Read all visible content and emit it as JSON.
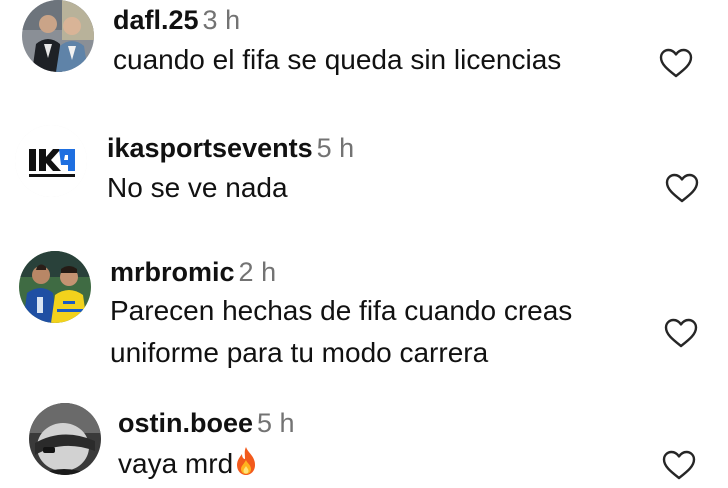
{
  "comments": [
    {
      "username": "dafl.25",
      "time": "3 h",
      "text": "cuando el fifa se queda sin licencias",
      "avatar_icon": "two-men-suits-photo"
    },
    {
      "username": "ikasportsevents",
      "time": "5 h",
      "text": "No se ve nada",
      "avatar_icon": "ika-sports-events-logo"
    },
    {
      "username": "mrbromic",
      "time": "2 h",
      "text_line1": "Parecen hechas de fifa cuando creas",
      "text_line2": "uniforme para tu modo carrera",
      "avatar_icon": "two-footballers-photo"
    },
    {
      "username": "ostin.boee",
      "time": "5 h",
      "text": "vaya mrd",
      "emoji": "fire-emoji",
      "avatar_icon": "masked-person-photo"
    }
  ],
  "colors": {
    "text": "#111111",
    "secondary": "#737373",
    "icon_stroke": "#262626",
    "logo_blue": "#1e6fe0"
  },
  "icons": {
    "like": "heart-outline-icon"
  }
}
